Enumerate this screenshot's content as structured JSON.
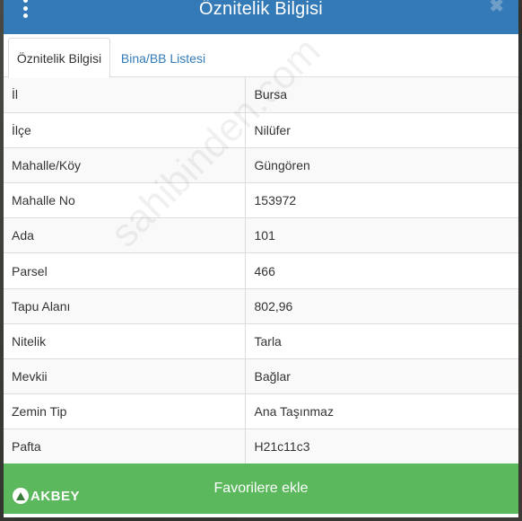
{
  "modal": {
    "title": "Öznitelik Bilgisi",
    "close_glyph": "✖"
  },
  "tabs": [
    {
      "label": "Öznitelik Bilgisi",
      "active": true
    },
    {
      "label": "Bina/BB Listesi",
      "active": false
    }
  ],
  "rows": [
    {
      "key": "İl",
      "value": "Bursa"
    },
    {
      "key": "İlçe",
      "value": "Nilüfer"
    },
    {
      "key": "Mahalle/Köy",
      "value": "Güngören"
    },
    {
      "key": "Mahalle No",
      "value": "153972"
    },
    {
      "key": "Ada",
      "value": "101"
    },
    {
      "key": "Parsel",
      "value": "466"
    },
    {
      "key": "Tapu Alanı",
      "value": "802,96"
    },
    {
      "key": "Nitelik",
      "value": "Tarla"
    },
    {
      "key": "Mevkii",
      "value": "Bağlar"
    },
    {
      "key": "Zemin Tip",
      "value": "Ana Taşınmaz"
    },
    {
      "key": "Pafta",
      "value": "H21c11c3"
    }
  ],
  "favorite_button_label": "Favorilere ekle",
  "watermark_text": "sahibinden.com",
  "logo_text": "AKBEY",
  "colors": {
    "header": "#337ab7",
    "button": "#5cb85c",
    "link": "#337ab7"
  },
  "icons": {
    "menu": "vertical-dots-icon",
    "close": "close-icon"
  }
}
